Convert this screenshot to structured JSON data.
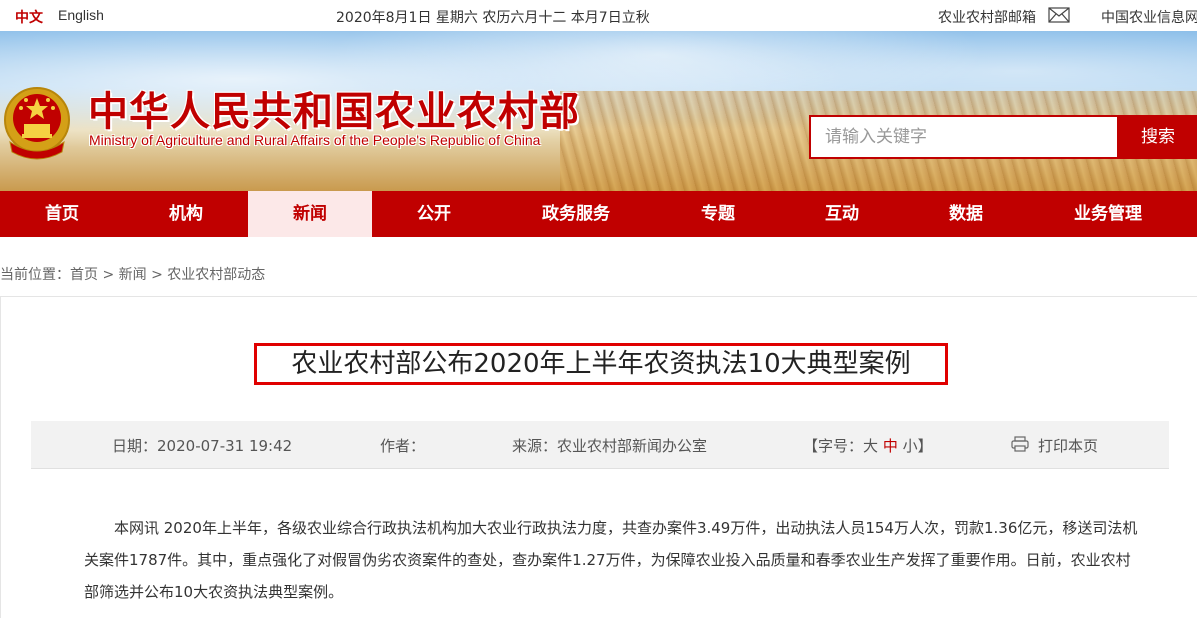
{
  "topbar": {
    "lang_zh": "中文",
    "lang_en": "English",
    "date": "2020年8月1日 星期六 农历六月十二 本月7日立秋",
    "mail_label": "农业农村部邮箱",
    "info_net_label": "中国农业信息网"
  },
  "header": {
    "title_cn": "中华人民共和国农业农村部",
    "title_en": "Ministry of Agriculture and Rural Affairs of the People's Republic of China",
    "search_placeholder": "请输入关键字",
    "search_button": "搜索"
  },
  "nav": {
    "items": [
      {
        "label": "首页"
      },
      {
        "label": "机构"
      },
      {
        "label": "新闻",
        "active": true
      },
      {
        "label": "公开"
      },
      {
        "label": "政务服务"
      },
      {
        "label": "专题"
      },
      {
        "label": "互动"
      },
      {
        "label": "数据"
      },
      {
        "label": "业务管理"
      }
    ]
  },
  "breadcrumb": {
    "prefix": "当前位置：",
    "items": [
      "首页",
      "新闻",
      "农业农村部动态"
    ],
    "separator": " > "
  },
  "article": {
    "title": "农业农村部公布2020年上半年农资执法10大典型案例",
    "meta": {
      "date_label": "日期：",
      "date": "2020-07-31 19:42",
      "author_label": "作者：",
      "source_label": "来源：",
      "source": "农业农村部新闻办公室",
      "font_size_prefix": "【字号：",
      "font_large": "大",
      "font_medium": "中",
      "font_small": "小",
      "font_size_suffix": "】",
      "print_label": "打印本页"
    },
    "body": "本网讯 2020年上半年，各级农业综合行政执法机构加大农业行政执法力度，共查办案件3.49万件，出动执法人员154万人次，罚款1.36亿元，移送司法机关案件1787件。其中，重点强化了对假冒伪劣农资案件的查处，查办案件1.27万件，为保障农业投入品质量和春季农业生产发挥了重要作用。日前，农业农村部筛选并公布10大农资执法典型案例。"
  },
  "colors": {
    "brand_red": "#c00000",
    "nav_active_bg": "#fce8e8",
    "meta_bg": "#f2f2f2"
  }
}
